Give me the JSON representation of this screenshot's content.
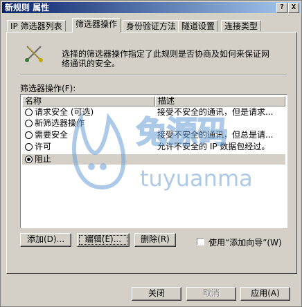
{
  "window": {
    "title": "新规则 属性",
    "help_btn": "?",
    "close_btn": "X"
  },
  "tabs": [
    "IP 筛选器列表",
    "筛选器操作",
    "身份验证方法",
    "隧道设置",
    "连接类型"
  ],
  "active_tab": 1,
  "description": "选择的筛选器操作指定了此规则是否协商及如何来保证网络通讯的安全。",
  "list": {
    "label": "筛选器操作(F):",
    "col_name": "名称",
    "col_desc": "描述",
    "rows": [
      {
        "name": "请求安全 (可选)",
        "desc": "接受不安全的通讯，但是请求..."
      },
      {
        "name": "新筛选器操作",
        "desc": ""
      },
      {
        "name": "需要安全",
        "desc": "接受不安全的通讯，但总是请..."
      },
      {
        "name": "许可",
        "desc": "允许不安全的 IP 数据包经过。"
      },
      {
        "name": "阻止",
        "desc": ""
      }
    ],
    "selected_index": 4
  },
  "buttons": {
    "add": "添加(D)...",
    "edit": "编辑(E)...",
    "remove": "删除(R)",
    "use_wizard": "使用“添加向导”(W)",
    "close": "关闭",
    "cancel": "取消",
    "apply": "应用(A)"
  },
  "watermark": {
    "text1": "兔源码",
    "text2": "tuyuanma"
  }
}
